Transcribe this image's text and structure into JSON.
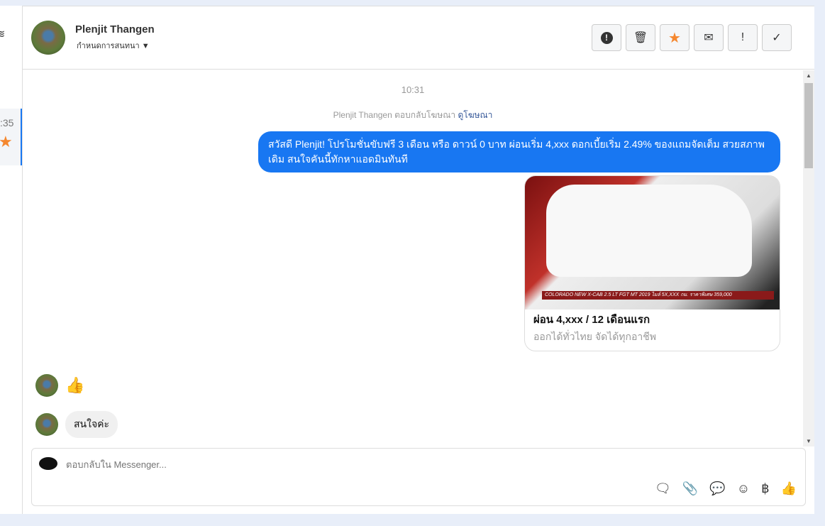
{
  "sidebar": {
    "time": ":35"
  },
  "header": {
    "name": "Plenjit Thangen",
    "assign": "กำหนดการสนทนา"
  },
  "actions": [
    {
      "name": "spam",
      "icon": "!"
    },
    {
      "name": "delete",
      "icon": "🗑"
    },
    {
      "name": "star",
      "icon": "★"
    },
    {
      "name": "unread",
      "icon": "✉"
    },
    {
      "name": "follow-up",
      "icon": "!"
    },
    {
      "name": "done",
      "icon": "✓"
    }
  ],
  "thread": {
    "timestamp": "10:31",
    "reply_prefix": "Plenjit Thangen ตอบกลับโฆษณา",
    "reply_link": "ดูโฆษณา",
    "outgoing": "สวัสดี Plenjit! โปรโมชั่นขับฟรี 3 เดือน หรือ ดาวน์ 0 บาท ผ่อนเริ่ม 4,xxx ดอกเบี้ยเริ่ม 2.49% ของแถมจัดเต็ม สวยสภาพเดิม สนใจคันนี้ทักหาแอดมินทันที",
    "card": {
      "image_caption": "COLORADO NEW X-CAB 2.5 LT FGT MT 2019 ไมล์ 5X,XXX กม. ราคาพิเศษ 359,000",
      "title": "ผ่อน 4,xxx / 12 เดือนแรก",
      "subtitle": "ออกได้ทั่วไทย จัดได้ทุกอาชีพ"
    },
    "incoming": "สนใจค่ะ"
  },
  "composer": {
    "placeholder": "ตอบกลับใน Messenger..."
  },
  "colors": {
    "accent": "#1877f2",
    "star": "#f5872e"
  }
}
